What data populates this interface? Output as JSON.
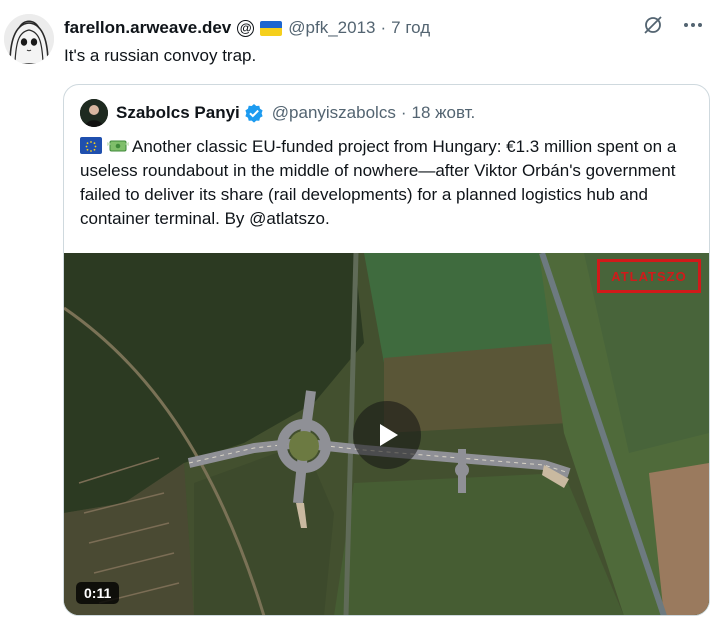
{
  "tweet": {
    "author_name": "farellon.arweave.dev",
    "author_badge": "@",
    "author_handle": "@pfk_2013",
    "separator": "·",
    "time": "7 год",
    "text": "It's a russian convoy trap.",
    "actions": {
      "grok_icon": "grok-icon",
      "more_icon": "more-icon"
    }
  },
  "quote": {
    "author_name": "Szabolcs Panyi",
    "author_handle": "@panyiszabolcs",
    "separator": "·",
    "time": "18 жовт.",
    "text": "Another classic EU-funded project from Hungary: €1.3 million spent on a useless roundabout in the middle of nowhere—after Viktor Orbán's government failed to deliver its share (rail developments) for a planned logistics hub and container terminal. By @atlatszo.",
    "media": {
      "duration": "0:11",
      "watermark": "ATLATSZO"
    }
  },
  "colors": {
    "text": "#0f1419",
    "muted": "#536471",
    "border": "#cfd9de",
    "verified": "#1d9bf0"
  }
}
